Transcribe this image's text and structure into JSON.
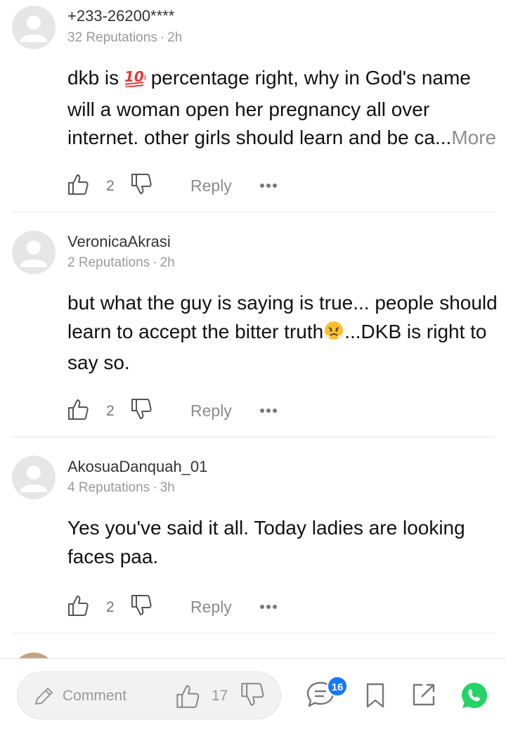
{
  "comments": [
    {
      "author": "+233-26200****",
      "reputations": "32 Reputations",
      "time": "2h",
      "text_before_emoji": "dkb is ",
      "emoji": "💯",
      "text_after_emoji": " percentage right, why in God's name will a woman open her pregnancy all over internet. other girls should learn and be ca...",
      "more_label": "More",
      "likes": "2",
      "reply_label": "Reply"
    },
    {
      "author": "VeronicaAkrasi",
      "reputations": "2 Reputations",
      "time": "2h",
      "text_before_emoji": "but what the guy is saying is true... people should learn to accept the bitter truth",
      "emoji": "😤",
      "text_after_emoji": "...DKB is right to say so.",
      "likes": "2",
      "reply_label": "Reply"
    },
    {
      "author": "AkosuaDanquah_01",
      "reputations": "4 Reputations",
      "time": "3h",
      "text": "Yes you've said it all. Today ladies are looking faces paa.",
      "likes": "2",
      "reply_label": "Reply"
    }
  ],
  "meta_separator": "·",
  "bottom_bar": {
    "comment_placeholder": "Comment",
    "likes": "17",
    "comments_badge": "16"
  },
  "colors": {
    "badge": "#1677ff",
    "whatsapp": "#25d366",
    "muted_text": "#9a9a9a"
  },
  "icons": [
    "avatar-placeholder-icon",
    "thumbs-up-icon",
    "thumbs-down-icon",
    "more-dots-icon",
    "pencil-icon",
    "comments-icon",
    "bookmark-icon",
    "share-icon",
    "whatsapp-icon"
  ]
}
